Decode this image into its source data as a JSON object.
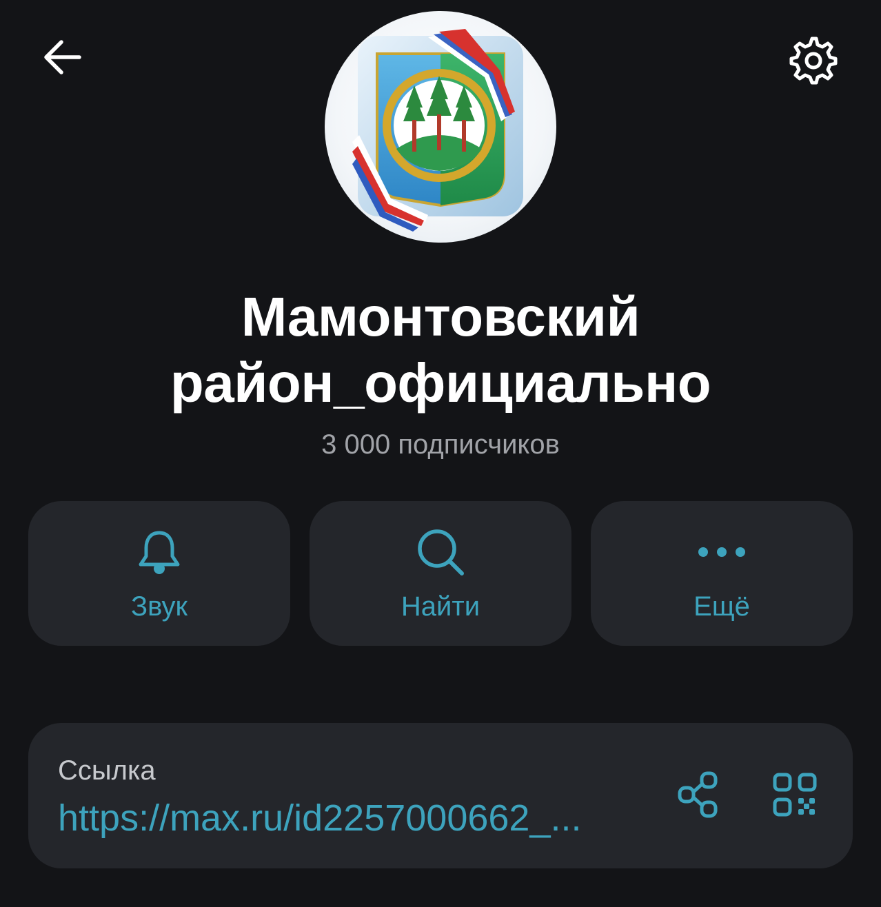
{
  "header": {
    "back_icon": "arrow-left-icon",
    "settings_icon": "gear-icon"
  },
  "profile": {
    "avatar": "coat-of-arms-emblem",
    "title_line1": "Мамонтовский",
    "title_line2": "район_официально",
    "subscribers": "3 000 подписчиков"
  },
  "actions": [
    {
      "label": "Звук",
      "icon": "bell-icon"
    },
    {
      "label": "Найти",
      "icon": "search-icon"
    },
    {
      "label": "Ещё",
      "icon": "more-dots-icon"
    }
  ],
  "link": {
    "caption": "Ссылка",
    "url": "https://max.ru/id2257000662_...",
    "share_icon": "share-icon",
    "qr_icon": "qr-code-icon"
  },
  "colors": {
    "background": "#131417",
    "card": "#24262b",
    "accent": "#3da3bd",
    "title": "#ffffff",
    "secondary_text": "#a1a3a8"
  }
}
